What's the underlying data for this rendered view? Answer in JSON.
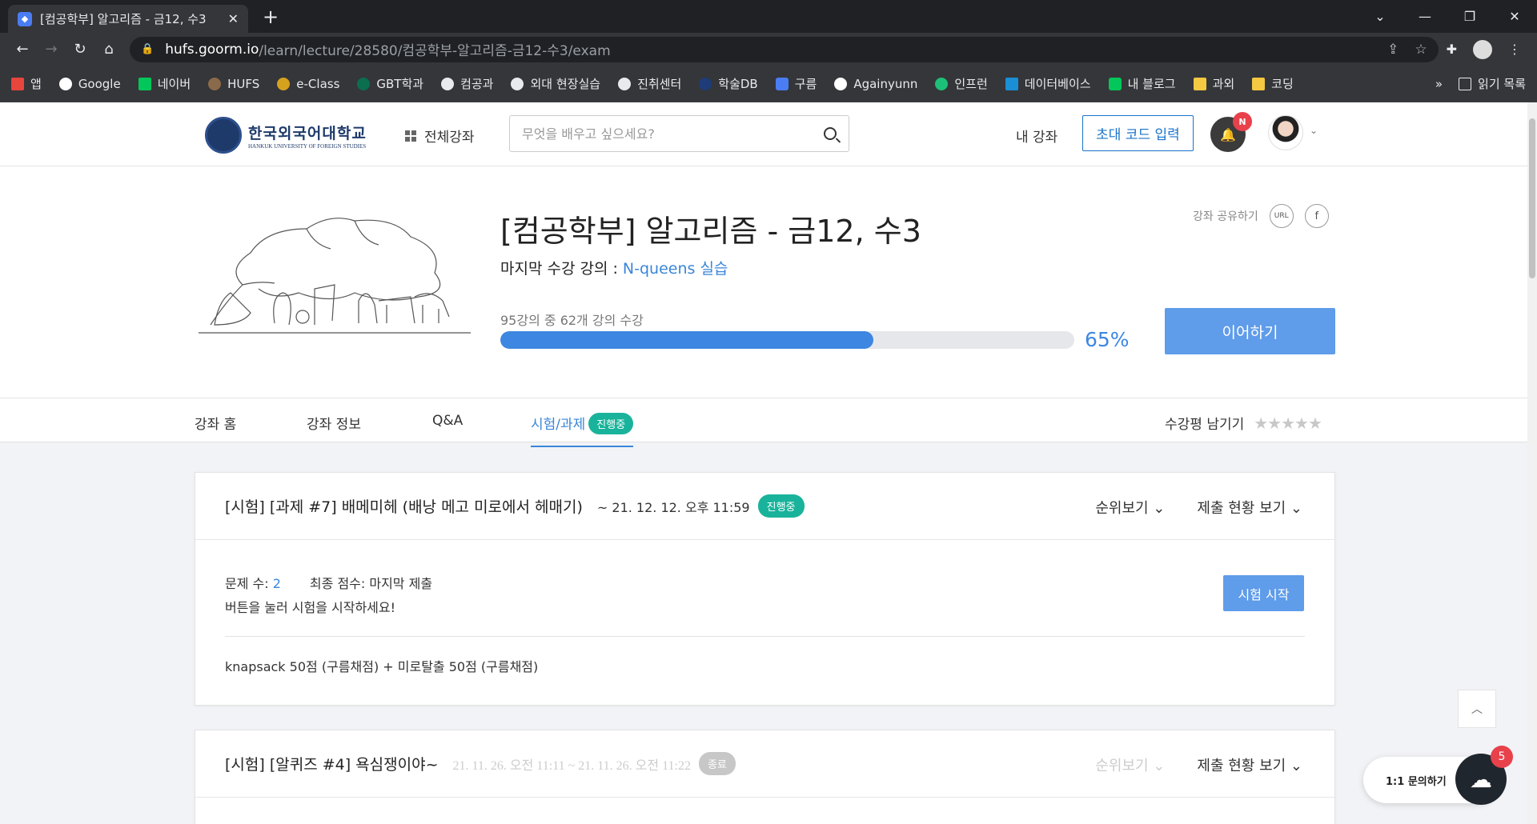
{
  "browser": {
    "tab_title": "[컴공학부] 알고리즘 - 금12, 수3",
    "url_host": "hufs.goorm.io",
    "url_path": "/learn/lecture/28580/컴공학부-알고리즘-금12-수3/exam",
    "bookmarks": [
      "앱",
      "Google",
      "네이버",
      "HUFS",
      "e-Class",
      "GBT학과",
      "컴공과",
      "외대 현장실습",
      "진취센터",
      "학술DB",
      "구름",
      "Againyunn",
      "인프런",
      "데이터베이스",
      "내 블로그",
      "과외",
      "코딩"
    ],
    "more": "»",
    "reading_list": "읽기 목록"
  },
  "header": {
    "logo_korean": "한국외국어대학교",
    "logo_english": "HANKUK UNIVERSITY OF FOREIGN STUDIES",
    "all_courses": "전체강좌",
    "search_placeholder": "무엇을 배우고 싶으세요?",
    "my_course": "내 강좌",
    "invite_code": "초대 코드 입력",
    "bell_badge": "N"
  },
  "course": {
    "title": "[컴공학부] 알고리즘 - 금12, 수3",
    "last_label": "마지막 수강 강의 : ",
    "last_link": "N-queens 실습",
    "share_label": "강좌 공유하기",
    "share_url": "URL",
    "share_fb": "f",
    "progress_text": "95강의 중 62개 강의 수강",
    "progress_fraction": 0.65,
    "progress_pct": "65%",
    "continue": "이어하기"
  },
  "tabs": [
    {
      "label": "강좌 홈"
    },
    {
      "label": "강좌 정보"
    },
    {
      "label": "Q&A"
    },
    {
      "label": "시험/과제",
      "badge": "진행중"
    }
  ],
  "review_label": "수강평 남기기",
  "review_stars": "★★★★★",
  "exams": [
    {
      "title": "[시험] [과제 #7] 배메미헤 (배낭 메고 미로에서 헤매기)",
      "date": "~ 21. 12. 12. 오후 11:59",
      "status": "진행중",
      "rank": "순위보기 ⌄",
      "submission": "제출 현황 보기 ⌄",
      "count_label": "문제 수: ",
      "count": "2",
      "score_label": "최종 점수: 마지막 제출",
      "hint": "버튼을 눌러 시험을 시작하세요!",
      "start": "시험 시작",
      "description": "knapsack 50점 (구름채점) + 미로탈출 50점 (구름채점)"
    },
    {
      "title": "[시험] [알퀴즈 #4] 욕심쟁이야~",
      "date": "21. 11. 26. 오전 11:11 ~ 21. 11. 26. 오전 11:22",
      "status": "종료",
      "rank": "순위보기 ⌄",
      "submission": "제출 현황 보기 ⌄"
    }
  ],
  "inquiry": "1:1 문의하기",
  "chat_badge": "5"
}
